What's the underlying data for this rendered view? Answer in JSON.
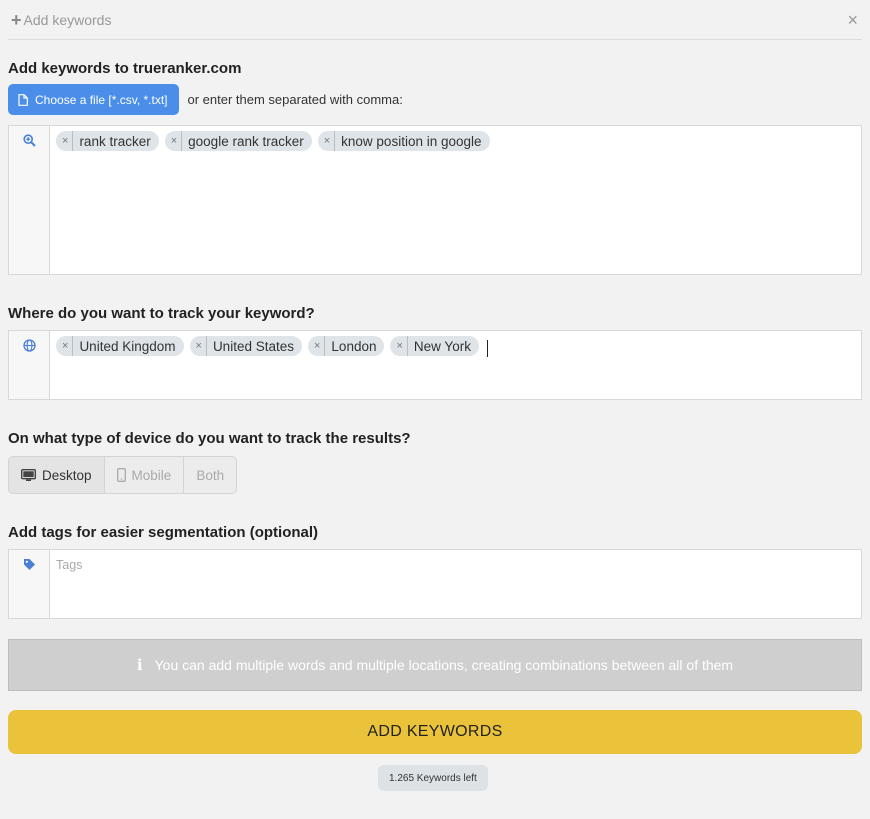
{
  "header": {
    "title": "Add keywords",
    "close_icon": "×"
  },
  "keywords_section": {
    "title": "Add keywords to trueranker.com",
    "file_button_label": "Choose a file [*.csv, *.txt]",
    "hint": "or enter them separated with comma:",
    "icon": "search-plus-icon",
    "tags": [
      "rank tracker",
      "google rank tracker",
      "know position in google"
    ]
  },
  "location_section": {
    "title": "Where do you want to track your keyword?",
    "icon": "globe-icon",
    "tags": [
      "United Kingdom",
      "United States",
      "London",
      "New York"
    ]
  },
  "device_section": {
    "title": "On what type of device do you want to track the results?",
    "options": [
      {
        "label": "Desktop",
        "icon": "desktop-icon",
        "active": true
      },
      {
        "label": "Mobile",
        "icon": "mobile-icon",
        "active": false
      },
      {
        "label": "Both",
        "icon": "",
        "active": false
      }
    ]
  },
  "tags_section": {
    "title": "Add tags for easier segmentation (optional)",
    "icon": "tag-icon",
    "placeholder": "Tags"
  },
  "info": {
    "icon": "i",
    "text": "You can add multiple words and multiple locations, creating combinations between all of them"
  },
  "submit": {
    "label": "ADD KEYWORDS"
  },
  "keywords_left": "1.265 Keywords left",
  "colors": {
    "primary_blue": "#4a8eea",
    "submit_yellow": "#ebc33a",
    "info_gray": "#cfcfcf"
  }
}
